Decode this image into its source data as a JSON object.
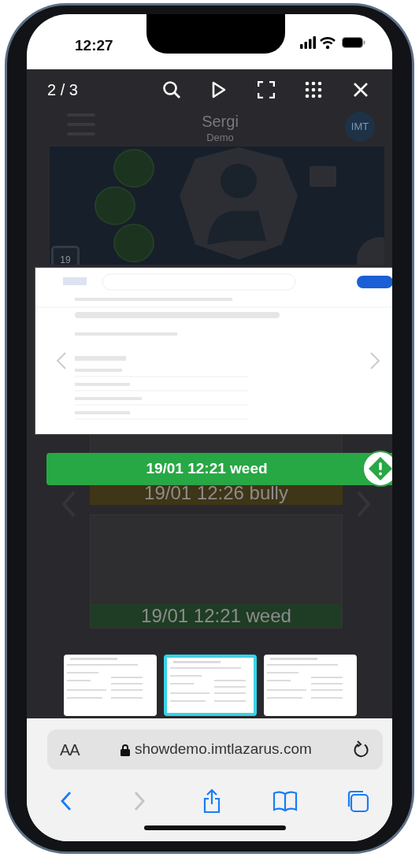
{
  "status_bar": {
    "time": "12:27"
  },
  "background_page": {
    "title": "Sergi",
    "subtitle": "Demo",
    "avatar": "IMT",
    "calendar_day": "19",
    "alerts": [
      {
        "label": "19/01 12:26 bully",
        "color": "#3f3517"
      },
      {
        "label": "19/01 12:21 weed",
        "color": "#1f3d24"
      }
    ]
  },
  "viewer": {
    "counter": "2 / 3",
    "capture": {
      "label": "19/01 12:21 weed",
      "color": "#28a745"
    },
    "thumbnails": [
      {
        "selected": false
      },
      {
        "selected": true
      },
      {
        "selected": false
      }
    ]
  },
  "browser": {
    "text_size": "AA",
    "url": "showdemo.imtlazarus.com",
    "nav": [
      {
        "kind": "back",
        "disabled": false
      },
      {
        "kind": "forward",
        "disabled": true
      },
      {
        "kind": "share",
        "disabled": false
      },
      {
        "kind": "bookmarks",
        "disabled": false
      },
      {
        "kind": "tabs",
        "disabled": false
      }
    ]
  }
}
